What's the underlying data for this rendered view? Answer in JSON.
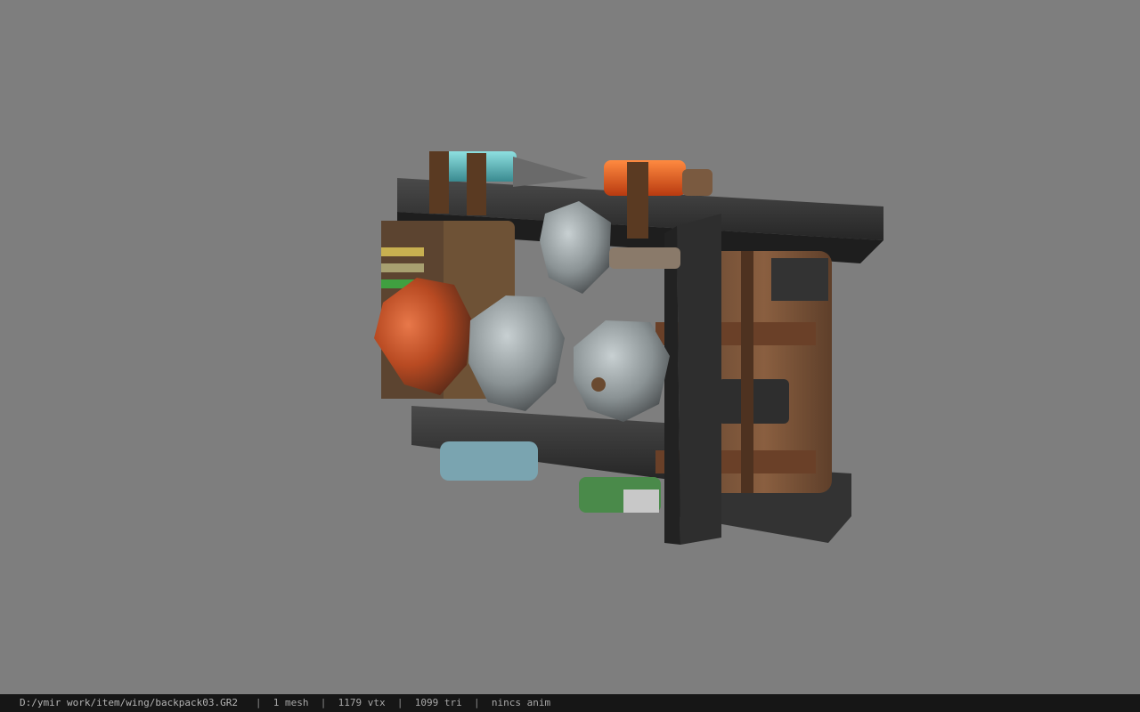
{
  "viewer": {
    "background_color": "#7e7e7e",
    "model_name": "backpack03"
  },
  "status": {
    "file_path": "D:/ymir work/item/wing/backpack03.GR2",
    "separator": "|",
    "meshes": "1 mesh",
    "vertices": "1179 vtx",
    "triangles": "1099 tri",
    "animation": "nincs anim"
  }
}
